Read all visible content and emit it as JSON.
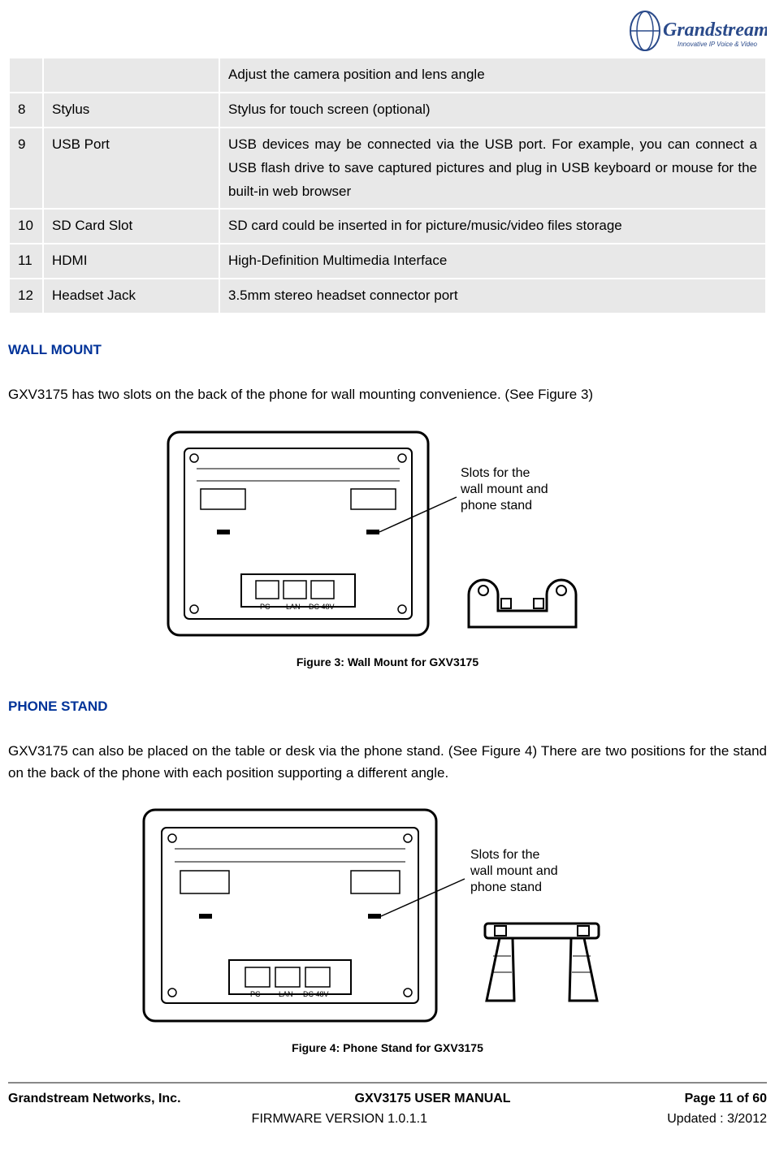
{
  "logo": {
    "brand": "Grandstream",
    "tagline": "Innovative IP Voice & Video"
  },
  "table": {
    "rows": [
      {
        "num": "",
        "name": "",
        "desc": "Adjust the camera position and lens angle"
      },
      {
        "num": "8",
        "name": "Stylus",
        "desc": "Stylus for touch screen (optional)"
      },
      {
        "num": "9",
        "name": "USB Port",
        "desc": "USB devices may be connected via the USB port. For example, you can connect a USB flash drive to save captured pictures and plug in USB keyboard or mouse for the built-in web browser"
      },
      {
        "num": "10",
        "name": "SD Card Slot",
        "desc": "SD card could be inserted in for picture/music/video files storage"
      },
      {
        "num": "11",
        "name": "HDMI",
        "desc": "High-Definition Multimedia Interface"
      },
      {
        "num": "12",
        "name": "Headset Jack",
        "desc": "3.5mm stereo headset connector port"
      }
    ]
  },
  "sections": {
    "wall_mount": {
      "heading": "WALL MOUNT",
      "body": "GXV3175 has two slots on the back of the phone for wall mounting convenience. (See Figure 3)"
    },
    "phone_stand": {
      "heading": "PHONE STAND",
      "body": "GXV3175 can also be placed on the table or desk via the phone stand. (See Figure 4) There are two positions for the stand on the back of the phone with each position supporting a different angle."
    }
  },
  "figures": {
    "fig3": {
      "caption": "Figure 3: Wall Mount for GXV3175",
      "callout": "Slots for the wall mount and phone stand"
    },
    "fig4": {
      "caption": "Figure 4: Phone Stand for GXV3175",
      "callout": "Slots for the wall mount and phone stand"
    }
  },
  "footer": {
    "company": "Grandstream Networks, Inc.",
    "manual": "GXV3175 USER MANUAL",
    "firmware": "FIRMWARE VERSION 1.0.1.1",
    "page": "Page 11 of 60",
    "updated": "Updated : 3/2012"
  }
}
